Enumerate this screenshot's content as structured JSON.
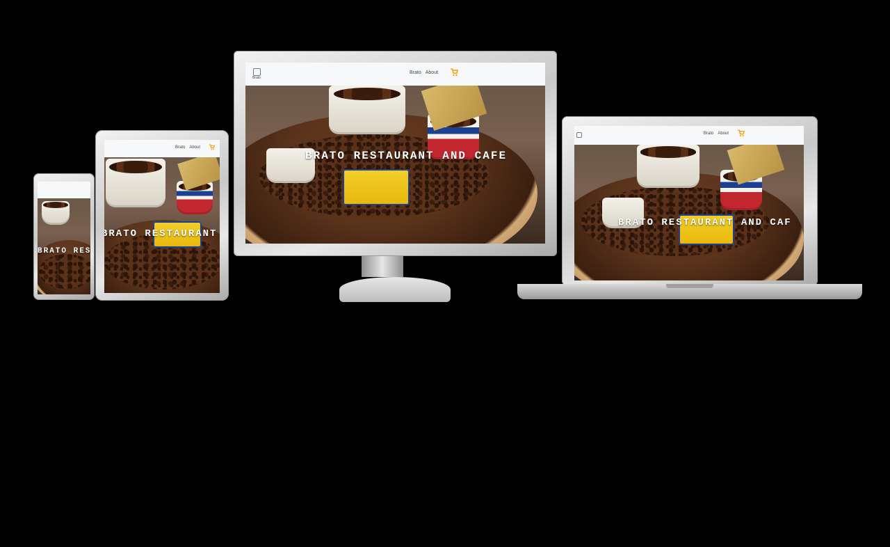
{
  "site": {
    "logo_text": "Brato",
    "nav": {
      "home": "Brato",
      "about": "About"
    },
    "hero_title": "BRATO RESTAURANT AND CAFE",
    "tablet_hero_title": "BRATO RESTAURANT",
    "phone_hero_title": "BRATO RESTA",
    "laptop_hero_title": "BRATO RESTAURANT AND CAF"
  },
  "icons": {
    "cart": "shopping-cart-icon"
  },
  "colors": {
    "accent": "#f59a00",
    "background": "#000000",
    "header": "#f7f8fa"
  }
}
